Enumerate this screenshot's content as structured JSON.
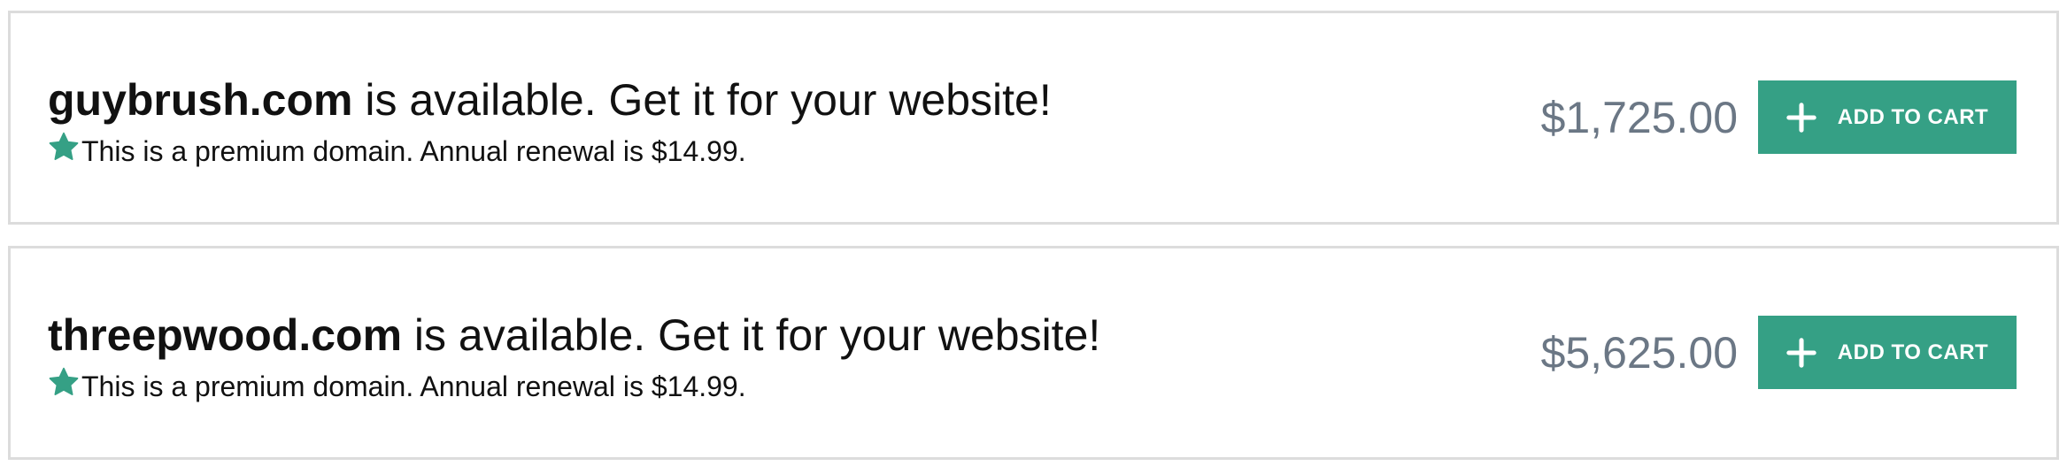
{
  "results": [
    {
      "domain": "guybrush.com",
      "availability_text": " is available. Get it for your website!",
      "premium_note": "This is a premium domain. Annual renewal is $14.99.",
      "price": "$1,725.00",
      "button_label": "ADD TO CART"
    },
    {
      "domain": "threepwood.com",
      "availability_text": " is available. Get it for your website!",
      "premium_note": "This is a premium domain. Annual renewal is $14.99.",
      "price": "$5,625.00",
      "button_label": "ADD TO CART"
    }
  ],
  "icons": {
    "premium": "star-icon",
    "add": "plus-icon"
  },
  "colors": {
    "accent": "#35a085",
    "price": "#6b7785",
    "border": "#dcdcdc"
  }
}
